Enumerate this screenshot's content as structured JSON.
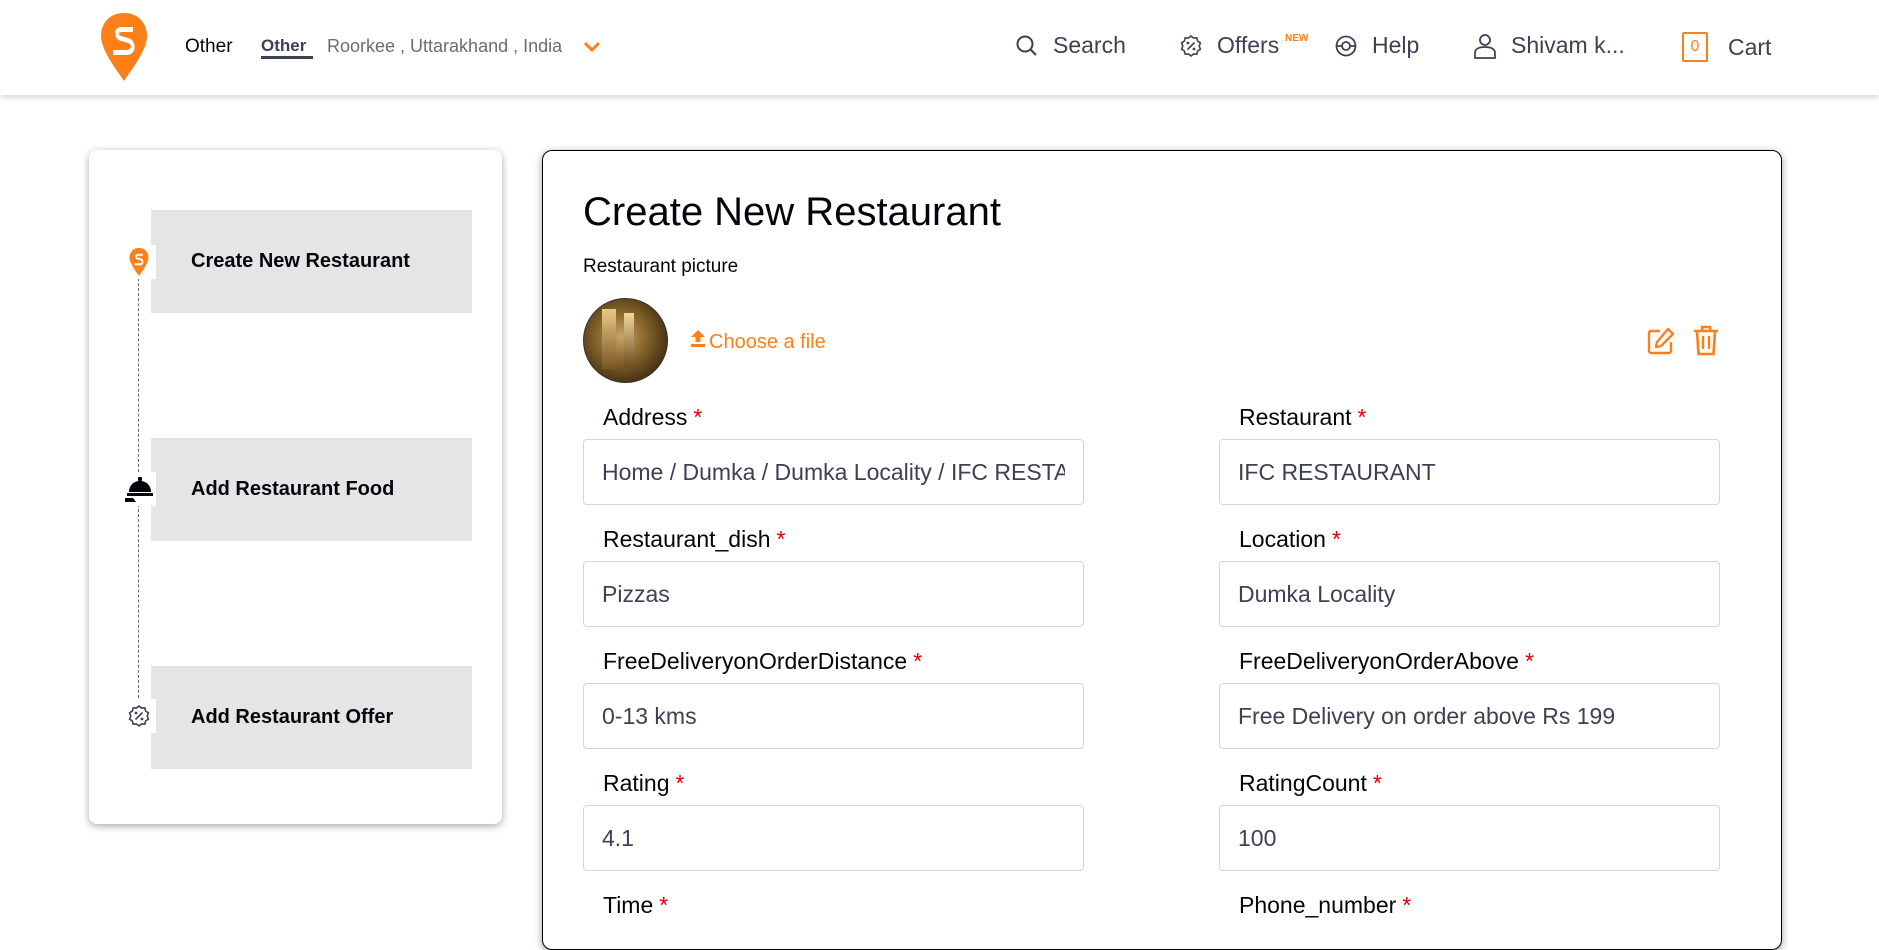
{
  "header": {
    "location_type": "Other",
    "location_sub": "Other",
    "location_text": "Roorkee , Uttarakhand , India",
    "nav": {
      "search": "Search",
      "offers": "Offers",
      "offers_badge": "NEW",
      "help": "Help",
      "user": "Shivam k...",
      "cart": "Cart",
      "cart_count": "0"
    },
    "brand_color": "#fc8019"
  },
  "sidebar": {
    "steps": [
      {
        "label": "Create New Restaurant",
        "icon": "swiggy-logo-icon"
      },
      {
        "label": "Add Restaurant Food",
        "icon": "food-cloche-icon"
      },
      {
        "label": "Add Restaurant Offer",
        "icon": "offer-percent-icon"
      }
    ]
  },
  "form": {
    "title": "Create New Restaurant",
    "picture_label": "Restaurant picture",
    "choose_file": "Choose a file",
    "fields": {
      "address": {
        "label": "Address",
        "value": "Home / Dumka / Dumka Locality / IFC RESTAURANT"
      },
      "restaurant": {
        "label": "Restaurant",
        "value": "IFC RESTAURANT"
      },
      "restaurant_dish": {
        "label": "Restaurant_dish",
        "value": "Pizzas"
      },
      "location": {
        "label": "Location",
        "value": "Dumka Locality"
      },
      "free_delivery_distance": {
        "label": "FreeDeliveryonOrderDistance",
        "value": "0-13 kms"
      },
      "free_delivery_above": {
        "label": "FreeDeliveryonOrderAbove",
        "value": "Free Delivery on order above Rs 199"
      },
      "rating": {
        "label": "Rating",
        "value": "4.1"
      },
      "rating_count": {
        "label": "RatingCount",
        "value": "100"
      },
      "time": {
        "label": "Time"
      },
      "phone_number": {
        "label": "Phone_number"
      }
    },
    "required_marker": "*"
  }
}
